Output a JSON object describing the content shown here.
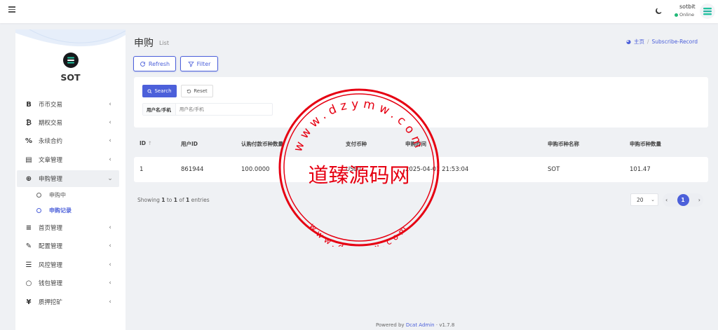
{
  "topbar": {
    "user_name": "sotbit",
    "user_status": "Online"
  },
  "sidebar": {
    "brand": "SOT",
    "items": [
      {
        "icon": "B",
        "label": "币币交易"
      },
      {
        "icon": "₿",
        "label": "期权交易"
      },
      {
        "icon": "%",
        "label": "永续合约"
      },
      {
        "icon": "▤",
        "label": "文章管理"
      },
      {
        "icon": "⊕",
        "label": "申购管理"
      },
      {
        "icon": "≡",
        "label": "首页管理"
      },
      {
        "icon": "✎",
        "label": "配置管理"
      },
      {
        "icon": "☰",
        "label": "风控管理"
      },
      {
        "icon": "○",
        "label": "钱包管理"
      },
      {
        "icon": "¥",
        "label": "质押挖矿"
      }
    ],
    "subitems": [
      {
        "label": "申购中"
      },
      {
        "label": "申购记录"
      }
    ]
  },
  "header": {
    "title": "申购",
    "subtitle": "List",
    "breadcrumb_home": "主页",
    "breadcrumb_current": "Subscribe-Record"
  },
  "toolbar": {
    "refresh_label": "Refresh",
    "filter_label": "Filter"
  },
  "filter": {
    "search_label": "Search",
    "reset_label": "Reset",
    "field_label": "用户名/手机",
    "field_placeholder": "用户名/手机"
  },
  "table": {
    "columns": [
      "ID",
      "用户ID",
      "认购付款币种数量",
      "支付币种",
      "申购时间",
      "申购币种名称",
      "申购币种数量"
    ],
    "rows": [
      [
        "1",
        "861944",
        "100.0000",
        "USDT",
        "2025-04-01 21:53:04",
        "SOT",
        "101.47"
      ]
    ]
  },
  "pagination": {
    "showing_prefix": "Showing",
    "from": "1",
    "to_word": "to",
    "to": "1",
    "of_word": "of",
    "total": "1",
    "entries_word": "entries",
    "per_page": "20",
    "current_page": "1"
  },
  "footer": {
    "powered_by": "Powered by",
    "link": "Dcat Admin",
    "version": "v1.7.8"
  },
  "watermark": {
    "center_text": "道臻源码网",
    "top_arc": "www.dzymw.com",
    "bottom_arc": "www.dzymw.com"
  },
  "colors": {
    "primary": "#4c60da",
    "online": "#21b978",
    "stamp": "#e60012"
  }
}
